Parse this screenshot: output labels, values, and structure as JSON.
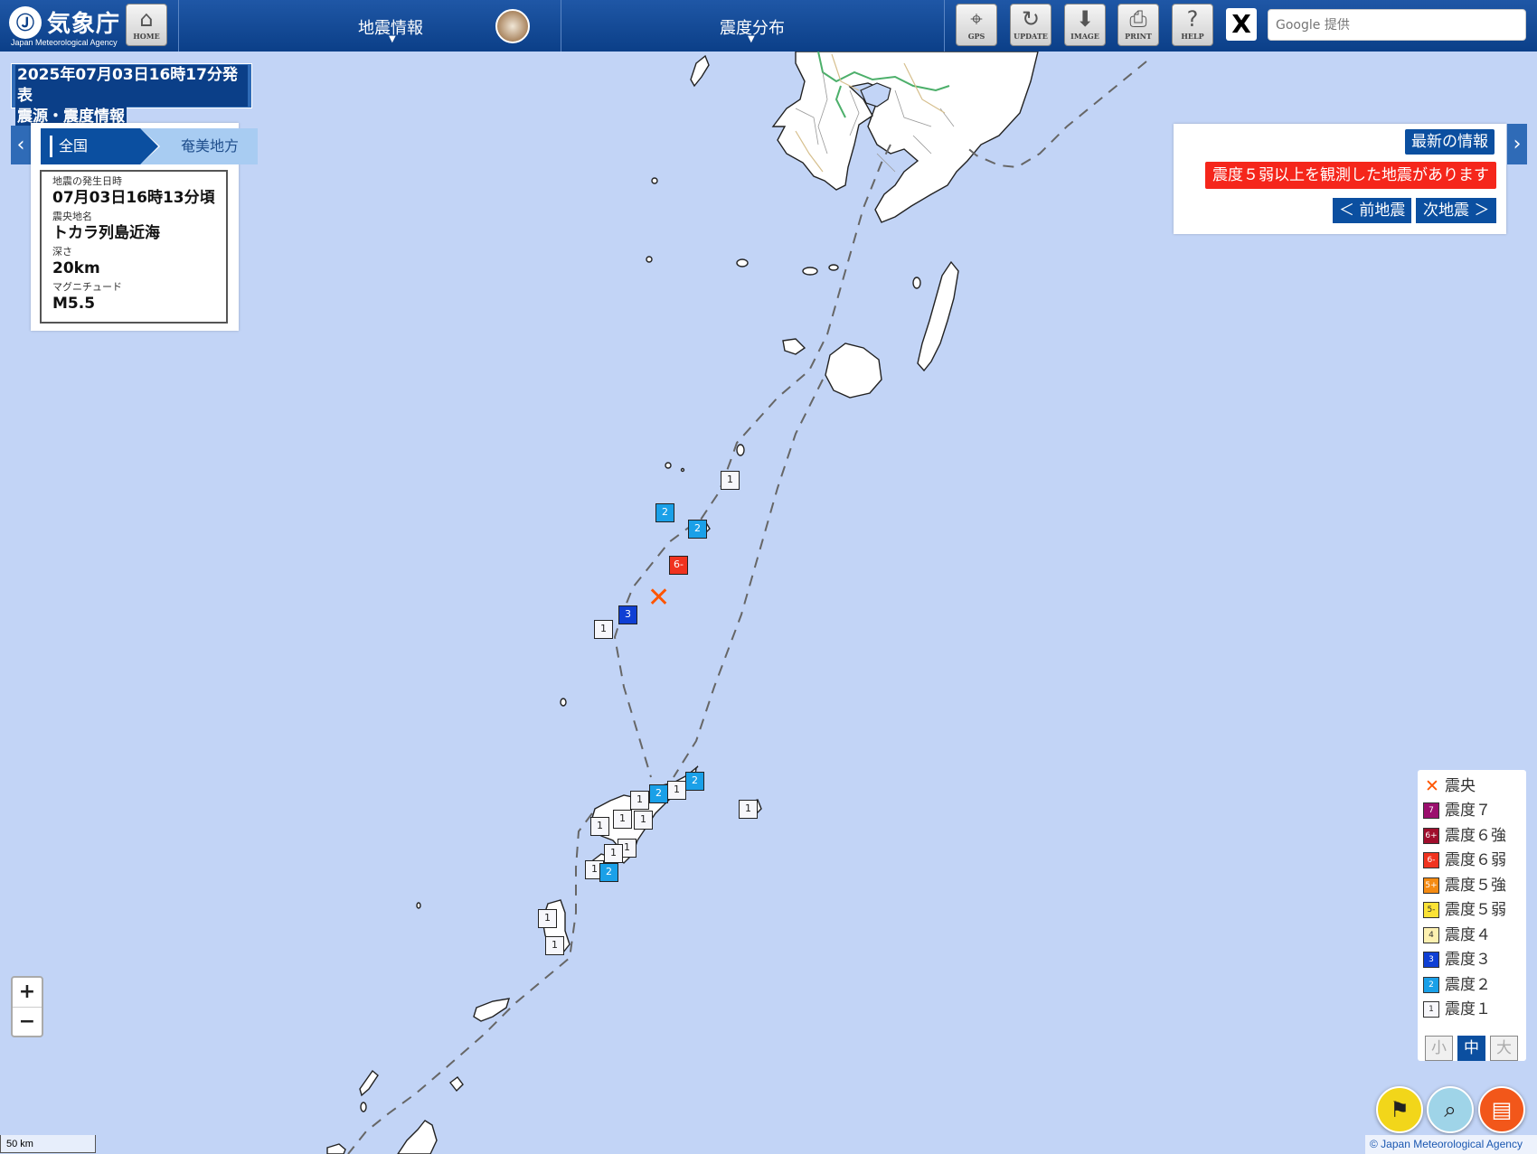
{
  "header": {
    "logo_text": "気象庁",
    "logo_sub": "Japan Meteorological Agency",
    "home_label": "HOME",
    "menu_eq_info": "地震情報",
    "menu_distribution": "震度分布",
    "tools": [
      {
        "label": "GPS",
        "icon": "gps-icon"
      },
      {
        "label": "UPDATE",
        "icon": "update-icon"
      },
      {
        "label": "IMAGE",
        "icon": "download-icon"
      },
      {
        "label": "PRINT",
        "icon": "print-icon"
      },
      {
        "label": "HELP",
        "icon": "help-icon"
      }
    ],
    "x_label": "X",
    "search_placeholder": "Google 提供"
  },
  "title_box": {
    "line1": "2025年07月03日16時17分発表",
    "line2": "震源・震度情報"
  },
  "breadcrumb": {
    "all": "全国",
    "region": "奄美地方"
  },
  "earthquake": {
    "time_label": "地震の発生日時",
    "time_value": "07月03日16時13分頃",
    "epicenter_label": "震央地名",
    "epicenter_value": "トカラ列島近海",
    "depth_label": "深さ",
    "depth_value": "20km",
    "magnitude_label": "マグニチュード",
    "magnitude_value": "M5.5"
  },
  "right_panel": {
    "latest_button": "最新の情報",
    "alert": "震度５弱以上を観測した地震があります",
    "prev_button": "＜ 前地震",
    "next_button": "次地震 ＞"
  },
  "legend": {
    "items": [
      {
        "label": "震央",
        "badge": "",
        "color": "#ff5500"
      },
      {
        "label": "震度７",
        "badge": "7",
        "color": "#9b0f6e"
      },
      {
        "label": "震度６強",
        "badge": "6+",
        "color": "#a00d2c"
      },
      {
        "label": "震度６弱",
        "badge": "6-",
        "color": "#f0331f"
      },
      {
        "label": "震度５強",
        "badge": "5+",
        "color": "#f58b12"
      },
      {
        "label": "震度５弱",
        "badge": "5-",
        "color": "#fbe235"
      },
      {
        "label": "震度４",
        "badge": "4",
        "color": "#fdf0b0"
      },
      {
        "label": "震度３",
        "badge": "3",
        "color": "#0f3fd4"
      },
      {
        "label": "震度２",
        "badge": "2",
        "color": "#1aa0e8"
      },
      {
        "label": "震度１",
        "badge": "1",
        "color": "#f7f7fb"
      }
    ],
    "sizes": [
      "小",
      "中",
      "大"
    ],
    "active_size": "中"
  },
  "stations": [
    {
      "value": "1"
    },
    {
      "value": "2"
    },
    {
      "value": "2"
    },
    {
      "value": "6-"
    },
    {
      "value": "3"
    },
    {
      "value": "1"
    },
    {
      "value": "2"
    },
    {
      "value": "1"
    },
    {
      "value": "2"
    },
    {
      "value": "1"
    },
    {
      "value": "1"
    },
    {
      "value": "1"
    },
    {
      "value": "1"
    },
    {
      "value": "1"
    },
    {
      "value": "1"
    },
    {
      "value": "1"
    },
    {
      "value": "2"
    },
    {
      "value": "1"
    },
    {
      "value": "1"
    }
  ],
  "zoom": {
    "plus": "+",
    "minus": "−"
  },
  "scale_label": "50 km",
  "copyright": "© Japan Meteorological Agency"
}
